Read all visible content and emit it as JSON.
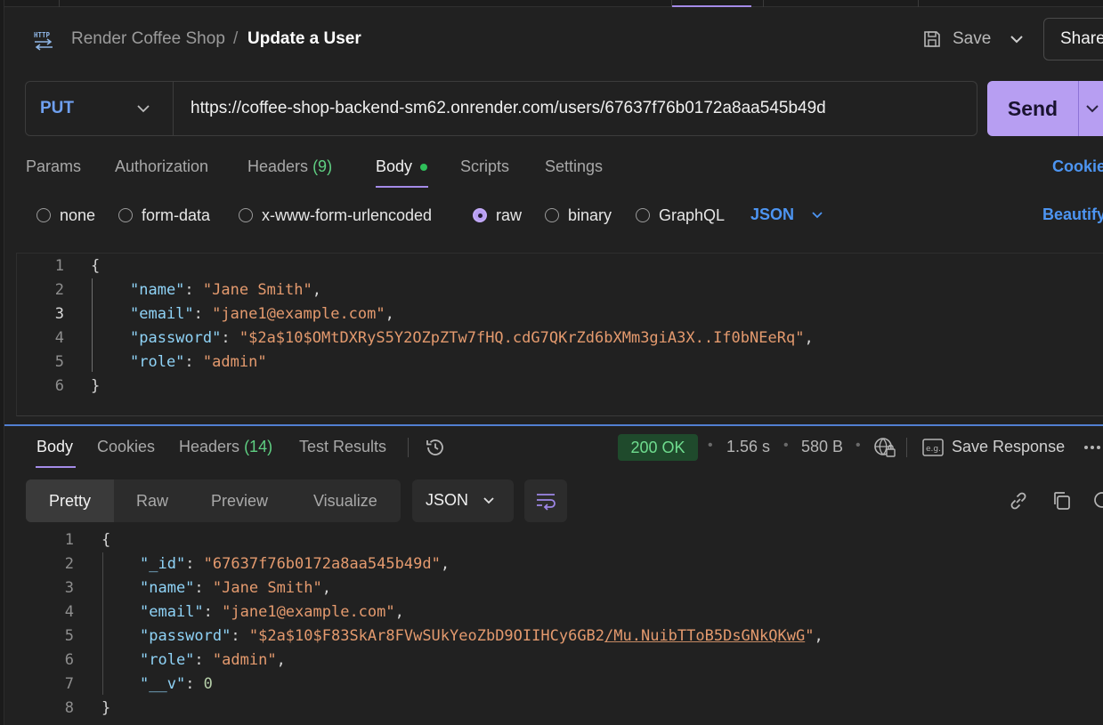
{
  "header": {
    "protocol_icon": "http-icon",
    "collection": "Render Coffee Shop",
    "separator": "/",
    "title": "Update a User",
    "save_label": "Save",
    "share_label": "Share"
  },
  "request": {
    "method": "PUT",
    "url": "https://coffee-shop-backend-sm62.onrender.com/users/67637f76b0172a8aa545b49d",
    "send_label": "Send"
  },
  "tabs": {
    "params": "Params",
    "authorization": "Authorization",
    "headers": "Headers",
    "headers_count": "(9)",
    "body": "Body",
    "scripts": "Scripts",
    "settings": "Settings",
    "cookies": "Cookies"
  },
  "body_types": {
    "none": "none",
    "form_data": "form-data",
    "urlencoded": "x-www-form-urlencoded",
    "raw": "raw",
    "binary": "binary",
    "graphql": "GraphQL",
    "selected": "raw",
    "format": "JSON",
    "beautify": "Beautify"
  },
  "request_body": {
    "line_numbers": [
      "1",
      "2",
      "3",
      "4",
      "5",
      "6"
    ],
    "current_line": "3",
    "open": "{",
    "close": "}",
    "fields": {
      "name": "Jane Smith",
      "email": "jane1@example.com",
      "password": "$2a$10$OMtDXRyS5Y2OZpZTw7fHQ.cdG7QKrZd6bXMm3giA3X..If0bNEeRq",
      "role": "admin"
    }
  },
  "response": {
    "tabs": {
      "body": "Body",
      "cookies": "Cookies",
      "headers": "Headers",
      "headers_count": "(14)",
      "test_results": "Test Results"
    },
    "status": "200 OK",
    "time": "1.56 s",
    "size": "580 B",
    "save_response": "Save Response",
    "views": {
      "pretty": "Pretty",
      "raw": "Raw",
      "preview": "Preview",
      "visualize": "Visualize"
    },
    "format": "JSON",
    "line_numbers": [
      "1",
      "2",
      "3",
      "4",
      "5",
      "6",
      "7",
      "8"
    ],
    "open": "{",
    "close": "}",
    "fields": {
      "_id": "67637f76b0172a8aa545b49d",
      "name": "Jane Smith",
      "email": "jane1@example.com",
      "password_plain": "$2a$10$F83SkAr8FVwSUkYeoZbD9OIIHCy6GB2",
      "password_linked": "/Mu.NuibTToB5DsGNkQKwG",
      "role": "admin",
      "__v": "0"
    }
  },
  "colors": {
    "accent": "#a48be8",
    "send_button": "#b79ef2",
    "link_blue": "#4d95f2",
    "status_green": "#6fdd8f",
    "json_key": "#8fd3f7",
    "json_string": "#e49a6e"
  }
}
